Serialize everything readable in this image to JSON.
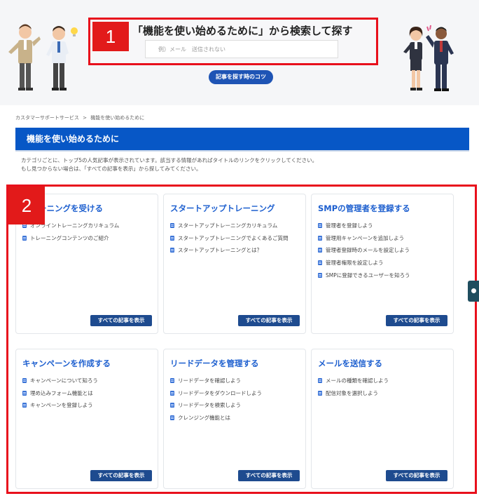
{
  "hero": {
    "number_tag": "1",
    "title": "「機能を使い始めるために」から検索して探す",
    "search_placeholder": "例）メール　送信されない",
    "tips_button": "記事を探す時のコツ"
  },
  "breadcrumb": {
    "home": "カスタマーサポートサービス",
    "separator": ">",
    "current": "機能を使い始めるために"
  },
  "page_title": "機能を使い始めるために",
  "description": [
    "カテゴリごとに、トップ5の人気記事が表示されています。該当する情報があればタイトルのリンクをクリックしてください。",
    "もし見つからない場合は、「すべての記事を表示」から探してみてください。"
  ],
  "cards_number_tag": "2",
  "cards": [
    {
      "title": "トレーニングを受ける",
      "items": [
        "オンライントレーニングカリキュラム",
        "トレーニングコンテンツのご紹介"
      ],
      "button": "すべての記事を表示"
    },
    {
      "title": "スタートアップトレーニング",
      "items": [
        "スタートアップトレーニングカリキュラム",
        "スタートアップトレーニングでよくあるご質問",
        "スタートアップトレーニングとは？"
      ],
      "button": "すべての記事を表示"
    },
    {
      "title": "SMPの管理者を登録する",
      "items": [
        "管理者を登録しよう",
        "管理用キャンペーンを追加しよう",
        "管理者登録時のメールを設定しよう",
        "管理者権限を設定しよう",
        "SMPに登録できるユーザーを知ろう"
      ],
      "button": "すべての記事を表示"
    },
    {
      "title": "キャンペーンを作成する",
      "items": [
        "キャンペーンについて知ろう",
        "埋め込みフォーム機能とは",
        "キャンペーンを登録しよう"
      ],
      "button": "すべての記事を表示"
    },
    {
      "title": "リードデータを管理する",
      "items": [
        "リードデータを確認しよう",
        "リードデータをダウンロードしよう",
        "リードデータを検索しよう",
        "クレンジング機能とは"
      ],
      "button": "すべての記事を表示"
    },
    {
      "title": "メールを送信する",
      "items": [
        "メールの種類を確認しよう",
        "配信対象を選択しよう"
      ],
      "button": "すべての記事を表示"
    }
  ],
  "colors": {
    "accent_blue": "#0757c6",
    "button_navy": "#1e4b8f",
    "highlight_red": "#e8101c"
  }
}
